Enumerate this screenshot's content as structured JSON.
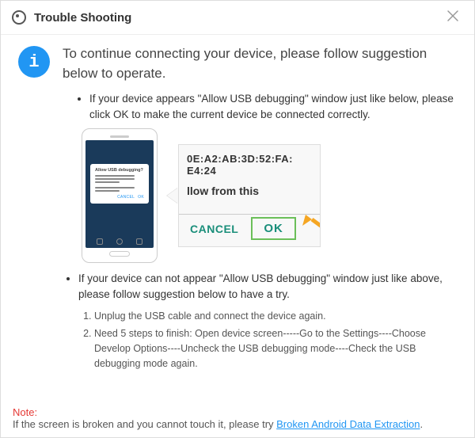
{
  "titlebar": {
    "title": "Trouble Shooting"
  },
  "headline": "To continue connecting your device, please follow suggestion below to operate.",
  "step1": "If your device appears \"Allow USB debugging\" window just like below, please click OK to make the current device  be connected correctly.",
  "phone_dialog_title": "Allow USB debugging?",
  "zoom": {
    "mac1": "0E:A2:AB:3D:52:FA:",
    "mac2": "E4:24",
    "allow": "llow from this",
    "cancel": "CANCEL",
    "ok": "OK"
  },
  "step2": "If your device can not appear \"Allow USB debugging\" window just like above, please follow suggestion below to have a try.",
  "sub1": "Unplug the USB cable and connect the device again.",
  "sub2": "Need 5 steps to finish: Open device screen-----Go to the Settings----Choose Develop Options----Uncheck the USB debugging mode----Check the USB debugging mode again.",
  "footer": {
    "note_label": "Note:",
    "text_before": "If the screen is broken and you cannot touch it, please try ",
    "link": "Broken Android Data Extraction",
    "text_after": "."
  }
}
